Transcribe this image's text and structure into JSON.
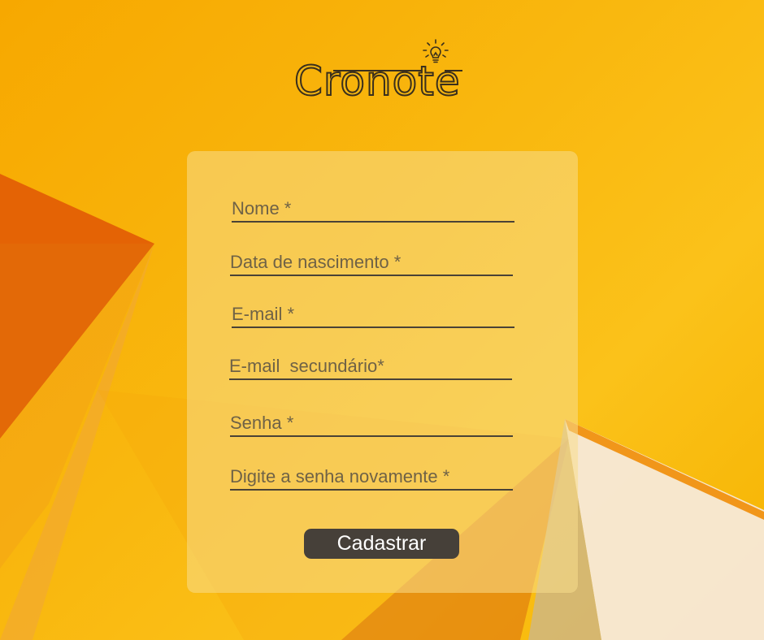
{
  "app": {
    "logo_text": "Cronote"
  },
  "form": {
    "fields": [
      {
        "placeholder": "Nome *",
        "value": ""
      },
      {
        "placeholder": "Data de nascimento *",
        "value": ""
      },
      {
        "placeholder": "E-mail *",
        "value": ""
      },
      {
        "placeholder": "E-mail  secundário*",
        "value": ""
      },
      {
        "placeholder": "Senha *",
        "value": ""
      },
      {
        "placeholder": "Digite a senha novamente *",
        "value": ""
      }
    ],
    "submit_label": "Cadastrar"
  },
  "colors": {
    "background": "#f9b80f",
    "shard_dark": "#e35f05",
    "shard_light": "#f2e6d6",
    "button": "#464039",
    "text": "#4a4236"
  },
  "icons": {
    "logo": "lightbulb-icon"
  }
}
